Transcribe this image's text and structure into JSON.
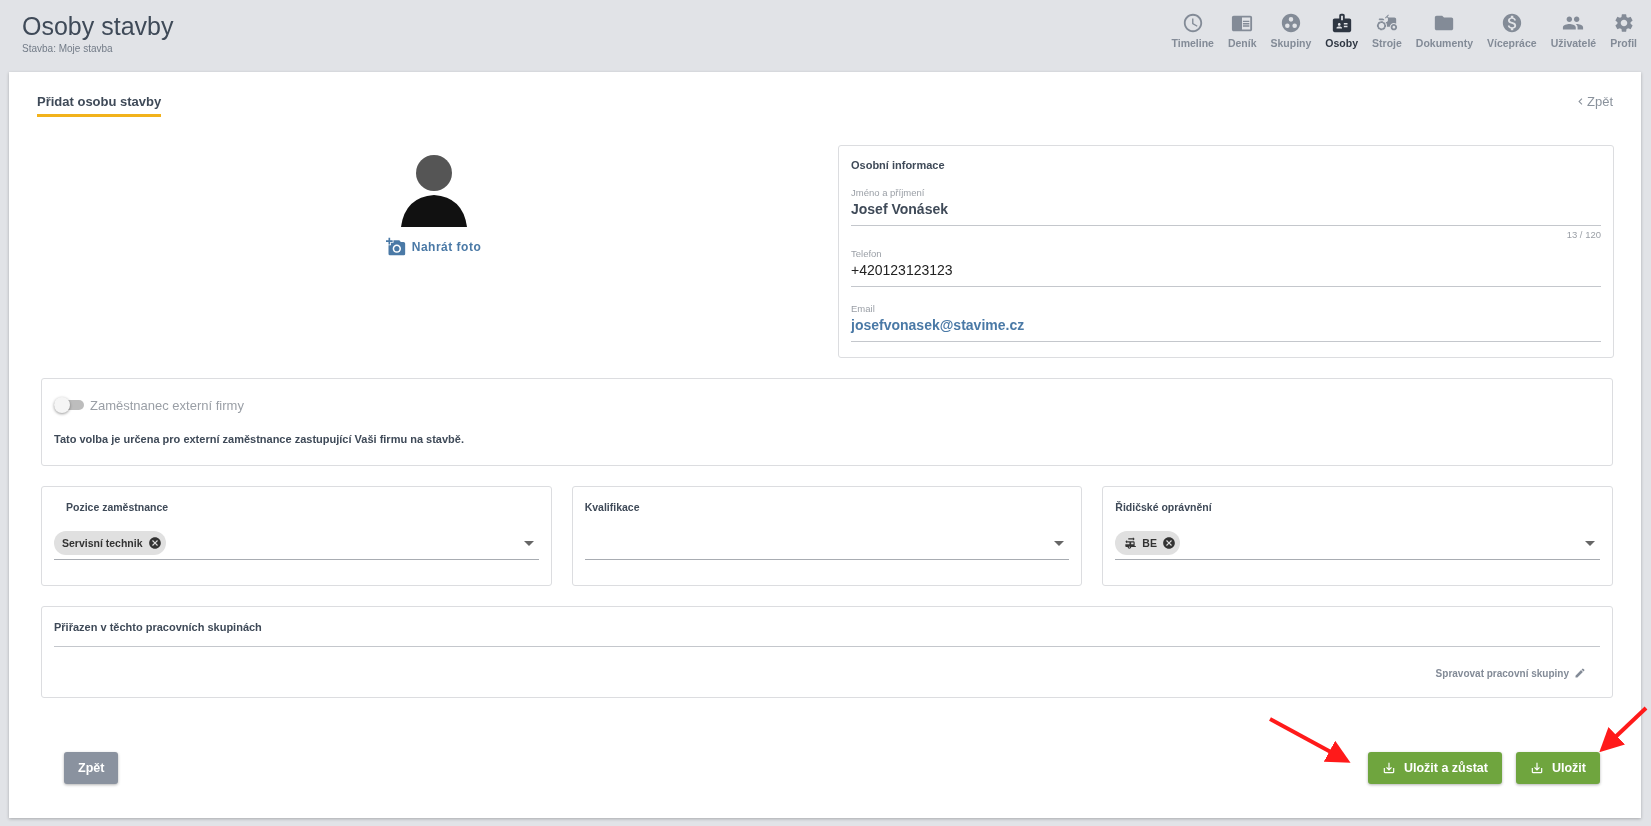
{
  "header": {
    "title": "Osoby stavby",
    "subtitle": "Stavba: Moje stavba",
    "nav": [
      {
        "label": "Timeline",
        "selected": false
      },
      {
        "label": "Deník",
        "selected": false
      },
      {
        "label": "Skupiny",
        "selected": false
      },
      {
        "label": "Osoby",
        "selected": true
      },
      {
        "label": "Stroje",
        "selected": false
      },
      {
        "label": "Dokumenty",
        "selected": false
      },
      {
        "label": "Vícepráce",
        "selected": false
      },
      {
        "label": "Uživatelé",
        "selected": false
      },
      {
        "label": "Profil",
        "selected": false
      }
    ]
  },
  "page_tab": "Přidat osobu stavby",
  "back_link": "Zpět",
  "photo": {
    "upload_label": "Nahrát foto"
  },
  "personal": {
    "title": "Osobní informace",
    "fields": [
      {
        "label": "Jméno a příjmení",
        "value": "Josef Vonásek",
        "counter": "13 / 120",
        "kind": "name"
      },
      {
        "label": "Telefon",
        "value": "+420123123123",
        "kind": "plain"
      },
      {
        "label": "Email",
        "value": "josefvonasek@stavime.cz",
        "kind": "link"
      }
    ]
  },
  "external": {
    "label": "Zaměstnanec externí firmy",
    "on": false,
    "note": "Tato volba je určena pro externí zaměstnance zastupující Vaši firmu na stavbě."
  },
  "selects": [
    {
      "label": "Pozice zaměstnance",
      "chips": [
        {
          "text": "Servisní technik",
          "kind": "text"
        }
      ]
    },
    {
      "label": "Kvalifikace"
    },
    {
      "label": "Řidičské oprávnění",
      "chips": [
        {
          "text": "BE",
          "kind": "vehicle"
        }
      ]
    }
  ],
  "groups": {
    "title": "Přiřazen v těchto pracovních skupinách",
    "manage_link": "Spravovat pracovní skupiny"
  },
  "buttons": {
    "back": "Zpět",
    "save_stay": "Uložit a zůstat",
    "save": "Uložit"
  }
}
